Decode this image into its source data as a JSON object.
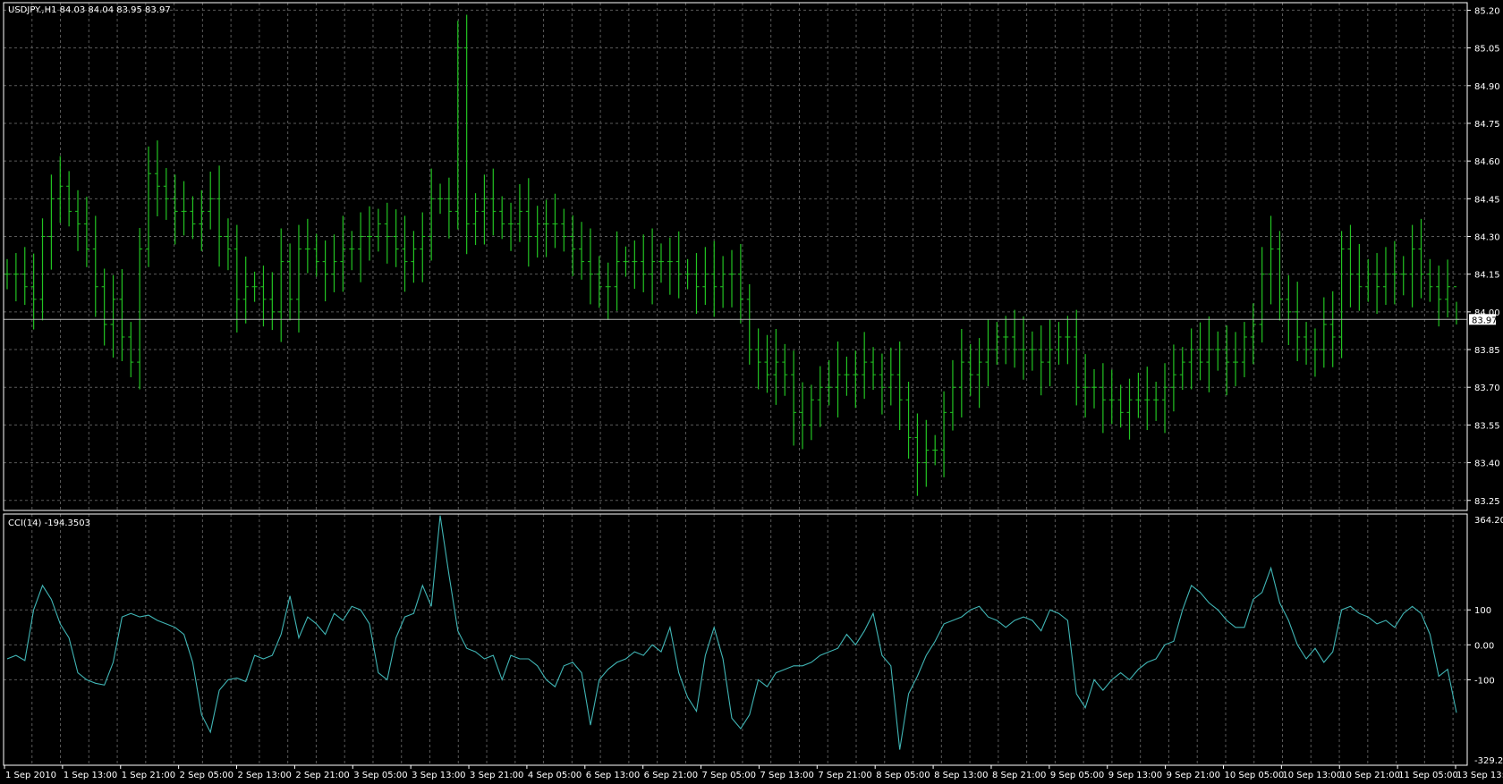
{
  "header": {
    "symbol_info": "USDJPY.,H1  84.03 84.04 83.95 83.97",
    "indicator_info": "CCI(14) -194.3503"
  },
  "colors": {
    "background": "#000000",
    "grid": "#5a5a5a",
    "bar": "#22c322",
    "cci_line": "#40b5b5",
    "price_line": "#b4b4b4",
    "text": "#ffffff"
  },
  "chart_data": [
    {
      "type": "ohlc",
      "symbol": "USDJPY.",
      "timeframe": "H1",
      "title": "USDJPY.,H1  84.03 84.04 83.95 83.97",
      "ylim": [
        83.21,
        85.23
      ],
      "y_ticks": [
        "85.20",
        "85.05",
        "84.90",
        "84.75",
        "84.60",
        "84.45",
        "84.30",
        "84.15",
        "84.00",
        "83.85",
        "83.70",
        "83.55",
        "83.40",
        "83.25"
      ],
      "current_price": "83.97",
      "last_bar": {
        "open": 84.03,
        "high": 84.04,
        "low": 83.95,
        "close": 83.97
      },
      "x_labels": [
        "1 Sep 2010",
        "1 Sep 13:00",
        "1 Sep 21:00",
        "2 Sep 05:00",
        "2 Sep 13:00",
        "2 Sep 21:00",
        "3 Sep 05:00",
        "3 Sep 13:00",
        "3 Sep 21:00",
        "4 Sep 05:00",
        "6 Sep 13:00",
        "6 Sep 21:00",
        "7 Sep 05:00",
        "7 Sep 13:00",
        "7 Sep 21:00",
        "8 Sep 05:00",
        "8 Sep 13:00",
        "8 Sep 21:00",
        "9 Sep 05:00",
        "9 Sep 13:00",
        "9 Sep 21:00",
        "10 Sep 05:00",
        "10 Sep 13:00",
        "10 Sep 21:00",
        "11 Sep 05:00",
        "13 Sep 13:00"
      ],
      "close_series": [
        84.15,
        84.15,
        84.1,
        84.05,
        84.3,
        84.45,
        84.5,
        84.4,
        84.35,
        84.25,
        84.1,
        83.95,
        84.05,
        83.9,
        83.8,
        84.25,
        84.55,
        84.5,
        84.45,
        84.4,
        84.4,
        84.35,
        84.4,
        84.45,
        84.3,
        84.25,
        84.05,
        84.1,
        84.1,
        84.05,
        84.0,
        84.2,
        84.05,
        84.25,
        84.25,
        84.2,
        84.15,
        84.2,
        84.25,
        84.25,
        84.3,
        84.3,
        84.35,
        84.3,
        84.25,
        84.2,
        84.25,
        84.3,
        84.45,
        84.45,
        84.4,
        85.05,
        84.35,
        84.4,
        84.45,
        84.4,
        84.35,
        84.35,
        84.4,
        84.3,
        84.35,
        84.35,
        84.35,
        84.3,
        84.25,
        84.2,
        84.15,
        84.1,
        84.1,
        84.2,
        84.2,
        84.2,
        84.15,
        84.2,
        84.2,
        84.2,
        84.15,
        84.15,
        84.1,
        84.15,
        84.1,
        84.15,
        84.15,
        84.05,
        83.85,
        83.8,
        83.75,
        83.8,
        83.75,
        83.6,
        83.55,
        83.65,
        83.7,
        83.7,
        83.75,
        83.75,
        83.75,
        83.8,
        83.75,
        83.7,
        83.75,
        83.65,
        83.5,
        83.4,
        83.45,
        83.45,
        83.6,
        83.7,
        83.8,
        83.75,
        83.8,
        83.85,
        83.9,
        83.9,
        83.85,
        83.85,
        83.85,
        83.8,
        83.85,
        83.9,
        83.9,
        83.7,
        83.7,
        83.7,
        83.65,
        83.65,
        83.6,
        83.65,
        83.65,
        83.65,
        83.65,
        83.7,
        83.75,
        83.8,
        83.85,
        83.8,
        83.85,
        83.85,
        83.8,
        83.8,
        83.9,
        83.95,
        84.15,
        84.25,
        84.05,
        84.0,
        83.9,
        83.85,
        83.85,
        83.95,
        83.9,
        84.25,
        84.15,
        84.1,
        84.15,
        84.1,
        84.15,
        84.15,
        84.15,
        84.25,
        84.15,
        84.1,
        84.05,
        84.1,
        83.97
      ]
    },
    {
      "type": "line",
      "title": "CCI(14) -194.3503",
      "series": [
        {
          "name": "CCI(14)",
          "last_value": -194.3503
        }
      ],
      "ylim": [
        -329.248,
        364.2015
      ],
      "y_ticks": [
        "364.2015",
        "100",
        "0.00",
        "-100",
        "-329.248"
      ],
      "values": [
        -40,
        -30,
        -45,
        100,
        170,
        130,
        60,
        20,
        -80,
        -100,
        -110,
        -115,
        -50,
        80,
        90,
        80,
        85,
        70,
        60,
        50,
        30,
        -50,
        -200,
        -250,
        -130,
        -100,
        -95,
        -105,
        -30,
        -40,
        -30,
        30,
        140,
        20,
        80,
        60,
        30,
        90,
        70,
        110,
        100,
        60,
        -80,
        -100,
        20,
        80,
        90,
        170,
        110,
        370,
        200,
        40,
        -10,
        -20,
        -40,
        -30,
        -100,
        -30,
        -40,
        -40,
        -60,
        -100,
        -120,
        -60,
        -50,
        -80,
        -230,
        -100,
        -70,
        -50,
        -40,
        -20,
        -30,
        0,
        -20,
        50,
        -80,
        -150,
        -190,
        -30,
        50,
        -40,
        -210,
        -240,
        -200,
        -100,
        -120,
        -80,
        -70,
        -60,
        -60,
        -50,
        -30,
        -20,
        -10,
        30,
        0,
        40,
        90,
        -30,
        -60,
        -300,
        -140,
        -90,
        -30,
        10,
        60,
        70,
        80,
        100,
        110,
        80,
        70,
        50,
        70,
        80,
        70,
        40,
        100,
        90,
        70,
        -140,
        -180,
        -100,
        -130,
        -100,
        -80,
        -100,
        -70,
        -50,
        -40,
        0,
        10,
        100,
        170,
        150,
        120,
        100,
        70,
        50,
        50,
        130,
        150,
        220,
        120,
        70,
        0,
        -40,
        -10,
        -50,
        -20,
        100,
        110,
        90,
        80,
        60,
        70,
        50,
        90,
        110,
        90,
        30,
        -90,
        -70,
        -194.35
      ]
    }
  ]
}
